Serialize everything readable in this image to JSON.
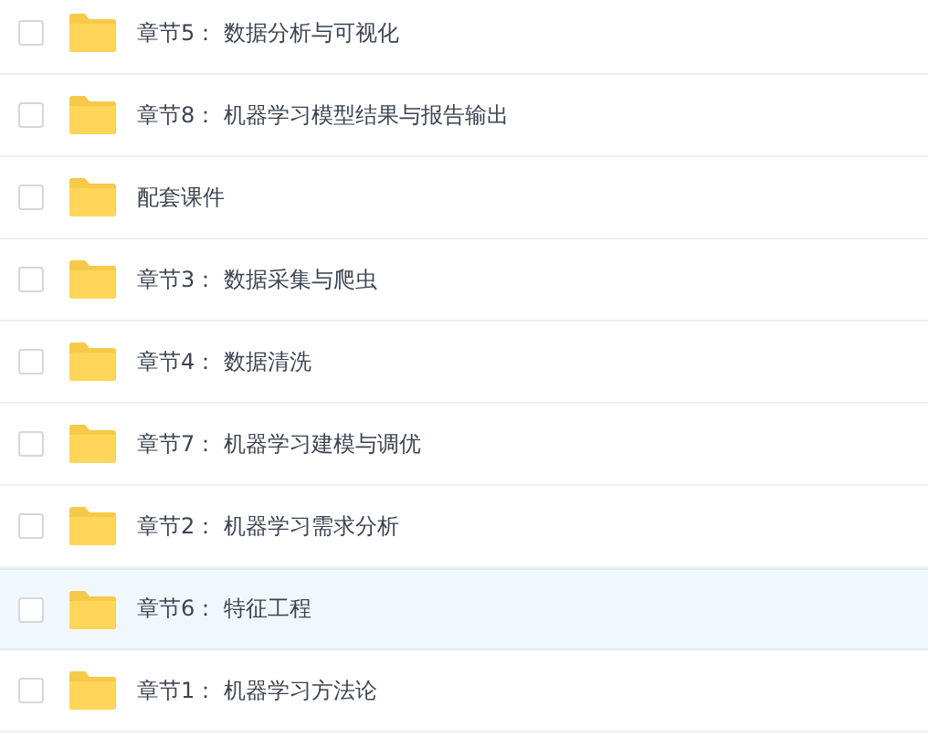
{
  "files": [
    {
      "name": "章节5： 数据分析与可视化",
      "checked": false,
      "selected": false
    },
    {
      "name": "章节8： 机器学习模型结果与报告输出",
      "checked": false,
      "selected": false
    },
    {
      "name": "配套课件",
      "checked": false,
      "selected": false
    },
    {
      "name": "章节3： 数据采集与爬虫",
      "checked": false,
      "selected": false
    },
    {
      "name": "章节4： 数据清洗",
      "checked": false,
      "selected": false
    },
    {
      "name": "章节7： 机器学习建模与调优",
      "checked": false,
      "selected": false
    },
    {
      "name": "章节2： 机器学习需求分析",
      "checked": false,
      "selected": false
    },
    {
      "name": "章节6： 特征工程",
      "checked": false,
      "selected": true
    },
    {
      "name": "章节1： 机器学习方法论",
      "checked": false,
      "selected": false
    }
  ]
}
